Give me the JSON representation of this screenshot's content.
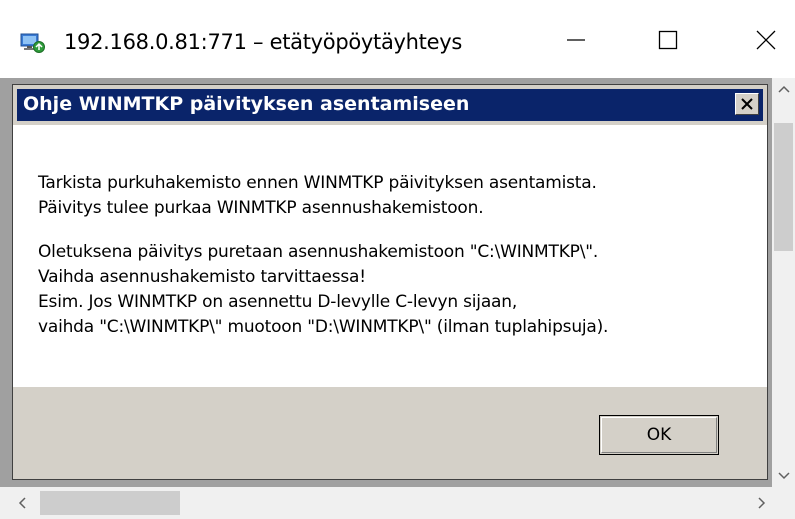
{
  "rdp_window": {
    "title": "192.168.0.81:771 – etätyöpöytäyhteys",
    "icons": {
      "app": "remote-desktop-icon",
      "minimize": "minimize-icon",
      "maximize": "maximize-icon",
      "close": "close-icon"
    }
  },
  "dialog": {
    "title": "Ohje WINMTKP päivityksen asentamiseen",
    "lines_block1": [
      "Tarkista purkuhakemisto ennen WINMTKP päivityksen asentamista.",
      "Päivitys tulee purkaa WINMTKP asennushakemistoon."
    ],
    "lines_block2": [
      "Oletuksena päivitys puretaan asennushakemistoon \"C:\\WINMTKP\\\".",
      "Vaihda asennushakemisto tarvittaessa!",
      "Esim. Jos WINMTKP on asennettu D-levylle C-levyn sijaan,",
      "vaihda \"C:\\WINMTKP\\\" muotoon \"D:\\WINMTKP\\\" (ilman tuplahipsuja)."
    ],
    "ok_label": "OK"
  },
  "colors": {
    "dialog_title_bg": "#0a246a",
    "dialog_face": "#d4d0c8",
    "remote_background": "#a0a0a0"
  }
}
